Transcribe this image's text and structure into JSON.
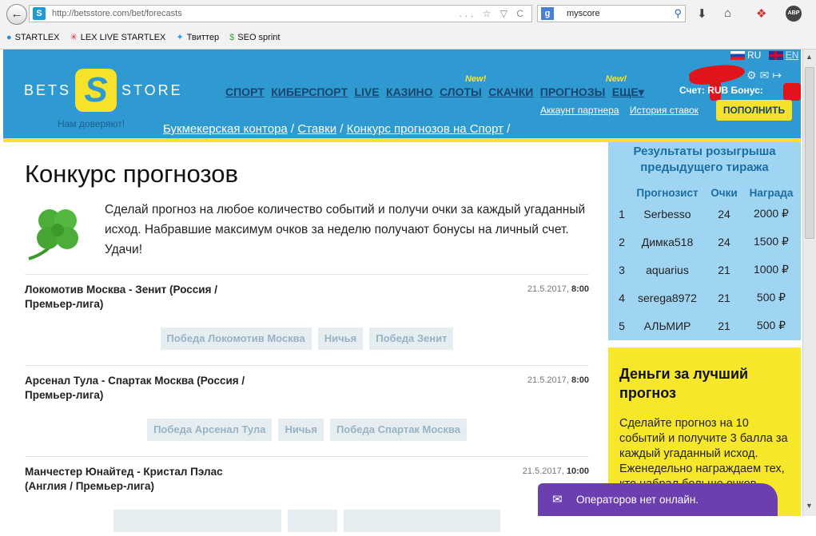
{
  "browser": {
    "url": "http://betsstore.com/bet/forecasts",
    "addr_tools": "... ☆ ▽ C",
    "search_value": "myscore",
    "search_engine_icon": "g-icon",
    "abp_label": "ABP",
    "bookmarks": [
      {
        "label": "STARTLEX",
        "icon": "person-icon"
      },
      {
        "label": "LEX LIVE STARTLEX",
        "icon": "star-icon"
      },
      {
        "label": "Твиттер",
        "icon": "twitter-icon"
      },
      {
        "label": "SEO sprint",
        "icon": "dollar-icon"
      }
    ]
  },
  "header": {
    "logo": {
      "left": "BETS",
      "mark": "S",
      "right": "STORE"
    },
    "tagline": "Нам доверяют!",
    "nav": [
      {
        "label": "СПОРТ",
        "badge": ""
      },
      {
        "label": "КИБЕРСПОРТ",
        "badge": ""
      },
      {
        "label": "LIVE",
        "badge": ""
      },
      {
        "label": "КАЗИНО",
        "badge": ""
      },
      {
        "label": "СЛОТЫ",
        "badge": "New!"
      },
      {
        "label": "СКАЧКИ",
        "badge": ""
      },
      {
        "label": "ПРОГНОЗЫ",
        "badge": ""
      },
      {
        "label": "ЕЩЕ",
        "badge": "New!"
      }
    ],
    "more_arrow": "▾",
    "lang_ru": "RU",
    "lang_en": "EN",
    "account": "Счет: RUB Бонус:",
    "links": [
      "Аккаунт партнера",
      "История ставок"
    ],
    "topup": "ПОПОЛНИТЬ"
  },
  "breadcrumb": [
    {
      "label": "Букмекерская контора",
      "sep": " / "
    },
    {
      "label": "Ставки",
      "sep": " / "
    },
    {
      "label": "Конкурс прогнозов на Спорт",
      "sep": " /"
    }
  ],
  "main": {
    "title": "Конкурс прогнозов",
    "intro": "Сделай прогноз на любое количество событий и получи очки за каждый угаданный исход. Набравшие максимум очков за неделю получают бонусы на личный счет. Удачи!",
    "events": [
      {
        "title": "Локомотив Москва - Зенит (Россия / Премьер-лига)",
        "date": "21.5.2017, ",
        "time": "8:00",
        "bets": [
          "Победа Локомотив Москва",
          "Ничья",
          "Победа Зенит"
        ]
      },
      {
        "title": "Арсенал Тула - Спартак Москва (Россия / Премьер-лига)",
        "date": "21.5.2017, ",
        "time": "8:00",
        "bets": [
          "Победа Арсенал Тула",
          "Ничья",
          "Победа Спартак Москва"
        ]
      },
      {
        "title": "Манчестер Юнайтед - Кристал Пэлас (Англия / Премьер-лига)",
        "date": "21.5.2017, ",
        "time": "10:00",
        "bets": [
          "",
          "",
          ""
        ]
      }
    ]
  },
  "sidebar": {
    "heading": "Результаты розыгрыша предыдущего тиража",
    "columns": [
      "",
      "Прогнозист",
      "Очки",
      "Награда"
    ],
    "rows": [
      [
        "1",
        "Serbesso",
        "24",
        "2000 ₽"
      ],
      [
        "2",
        "Димка518",
        "24",
        "1500 ₽"
      ],
      [
        "3",
        "aquarius",
        "21",
        "1000 ₽"
      ],
      [
        "4",
        "serega8972",
        "21",
        "500 ₽"
      ],
      [
        "5",
        "АЛЬМИР",
        "21",
        "500 ₽"
      ]
    ]
  },
  "promo": {
    "heading": "Деньги за лучший прогноз",
    "text": "Сделайте прогноз на 10 событий и получите 3 балла за каждый угаданный исход. Еженедельно награждаем тех, кто набрал больше очков."
  },
  "chat": {
    "text": "Операторов нет онлайн."
  },
  "colors": {
    "header": "#2f9ad2",
    "accent": "#f6e12b",
    "sidebar": "#9fd5f3",
    "chat": "#6b3fb0"
  }
}
